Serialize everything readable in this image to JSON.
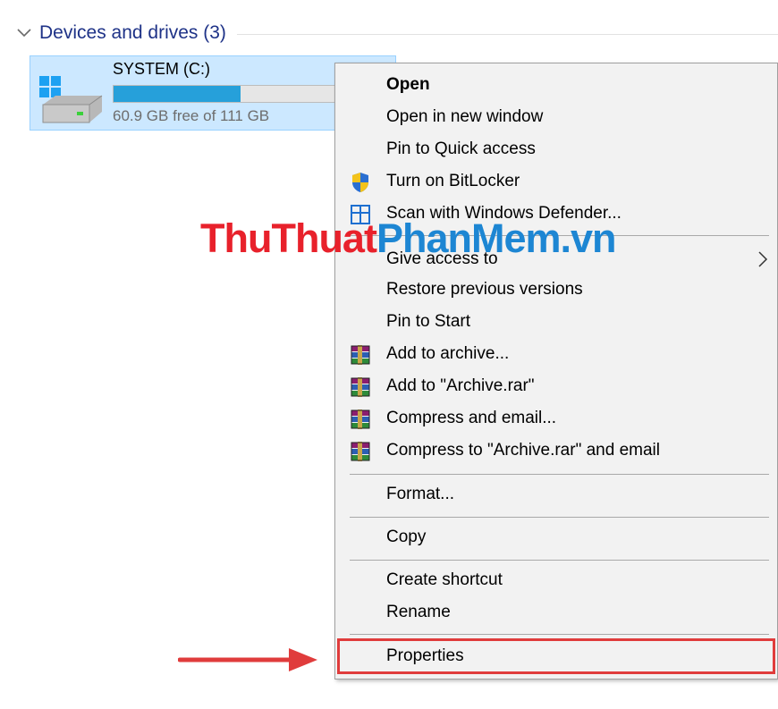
{
  "group": {
    "title": "Devices and drives (3)"
  },
  "drive": {
    "name": "SYSTEM (C:)",
    "space_text": "60.9 GB free of 111 GB",
    "used_fraction": 0.45,
    "bar_color": "#26a0da",
    "icon": "hard-drive-windows-icon"
  },
  "context_menu": {
    "items": [
      {
        "label": "Open",
        "bold": true
      },
      {
        "label": "Open in new window"
      },
      {
        "label": "Pin to Quick access"
      },
      {
        "label": "Turn on BitLocker",
        "icon": "bitlocker-shield-icon"
      },
      {
        "label": "Scan with Windows Defender...",
        "icon": "windows-defender-icon"
      },
      {
        "label": "Give access to",
        "submenu": true
      },
      {
        "label": "Restore previous versions"
      },
      {
        "label": "Pin to Start"
      },
      {
        "label": "Add to archive...",
        "icon": "winrar-icon"
      },
      {
        "label": "Add to \"Archive.rar\"",
        "icon": "winrar-icon"
      },
      {
        "label": "Compress and email...",
        "icon": "winrar-icon"
      },
      {
        "label": "Compress to \"Archive.rar\" and email",
        "icon": "winrar-icon"
      },
      {
        "label": "Format..."
      },
      {
        "label": "Copy"
      },
      {
        "label": "Create shortcut"
      },
      {
        "label": "Rename"
      },
      {
        "label": "Properties",
        "highlighted": true
      }
    ]
  },
  "watermark": {
    "part1": "ThuThuat",
    "part2": "PhanMem",
    "part3": ".vn"
  },
  "colors": {
    "highlight": "#e03c3c",
    "selection": "#cce8ff",
    "accent": "#1e3287"
  }
}
